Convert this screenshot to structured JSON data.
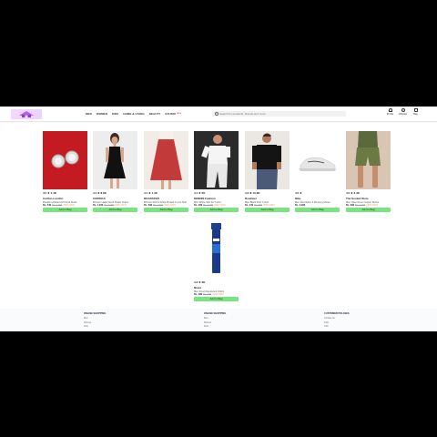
{
  "header": {
    "nav": [
      "MEN",
      "WOMEN",
      "KIDS",
      "HOME & LIVING",
      "BEAUTY",
      "STUDIO"
    ],
    "nav_badge": "NEW",
    "search_placeholder": "Search for products, brands and more",
    "actions": [
      {
        "icon": "profile-icon",
        "label": "Profile"
      },
      {
        "icon": "heart-icon",
        "label": "Wishlist"
      },
      {
        "icon": "bag-icon",
        "label": "Bag"
      }
    ]
  },
  "products": [
    {
      "rating": "4.5 ★ 1.4K",
      "brand": "Carlton London",
      "title": "Rhodium-Plated CZ Floral Studs",
      "price": "Rs. 549",
      "mrp": "Rs. 1,399",
      "off": "(60% OFF)",
      "button": "Add to Bag"
    },
    {
      "rating": "4.4 ★ 8.6K",
      "brand": "CORSICA",
      "title": "Women Halter Neck Skater Dress",
      "price": "Rs. 1,032",
      "mrp": "Rs. 3,350",
      "off": "(69% OFF)",
      "button": "Add to Bag"
    },
    {
      "rating": "4.1 ★ 1.4K",
      "brand": "ROADSTER",
      "title": "Women Red & White Printed A-Line Skirt",
      "price": "Rs. 599",
      "mrp": "Rs. 1,499",
      "off": "(60% OFF)",
      "button": "Add to Bag"
    },
    {
      "rating": "4.1 ★ 5K",
      "brand": "DENNIS Fashion",
      "title": "Men White Slim Fit T-shirt",
      "price": "Rs. 499",
      "mrp": "Rs. 1,299",
      "off": "(62% OFF)",
      "button": "Add to Bag"
    },
    {
      "rating": "4.2 ★ 10.2K",
      "brand": "Roadster",
      "title": "Men Black Polo T-shirt",
      "price": "Rs. 449",
      "mrp": "Rs. 999",
      "off": "(55% OFF)",
      "button": "Add to Bag"
    },
    {
      "rating": "4.5 ★",
      "brand": "Nike",
      "title": "Men Revolution 6 Running Shoes",
      "price": "Rs. 3,295",
      "mrp": "",
      "off": "",
      "button": "Add to Bag"
    },
    {
      "rating": "4.0 ★ 3.4K",
      "brand": "The Souled Store",
      "title": "Men Olive Green Cotton Shorts",
      "price": "Rs. 699",
      "mrp": "Rs. 1,299",
      "off": "(46% OFF)",
      "button": "Add to Bag"
    },
    {
      "rating": "4.3 ★ 3K",
      "brand": "Nivea",
      "title": "Men Fresh Deodorant 150ml",
      "price": "Rs. 189",
      "mrp": "Rs. 245",
      "off": "(22% OFF)",
      "button": "Add to Bag"
    }
  ],
  "footer": [
    {
      "heading": "ONLINE SHOPPING",
      "links": [
        "Men",
        "Women",
        "Kids"
      ]
    },
    {
      "heading": "ONLINE SHOPPING",
      "links": [
        "Men",
        "Women",
        "Kids"
      ]
    },
    {
      "heading": "CUSTOMER POLICIES",
      "links": [
        "Contact Us",
        "FAQ",
        "T&C"
      ]
    }
  ]
}
